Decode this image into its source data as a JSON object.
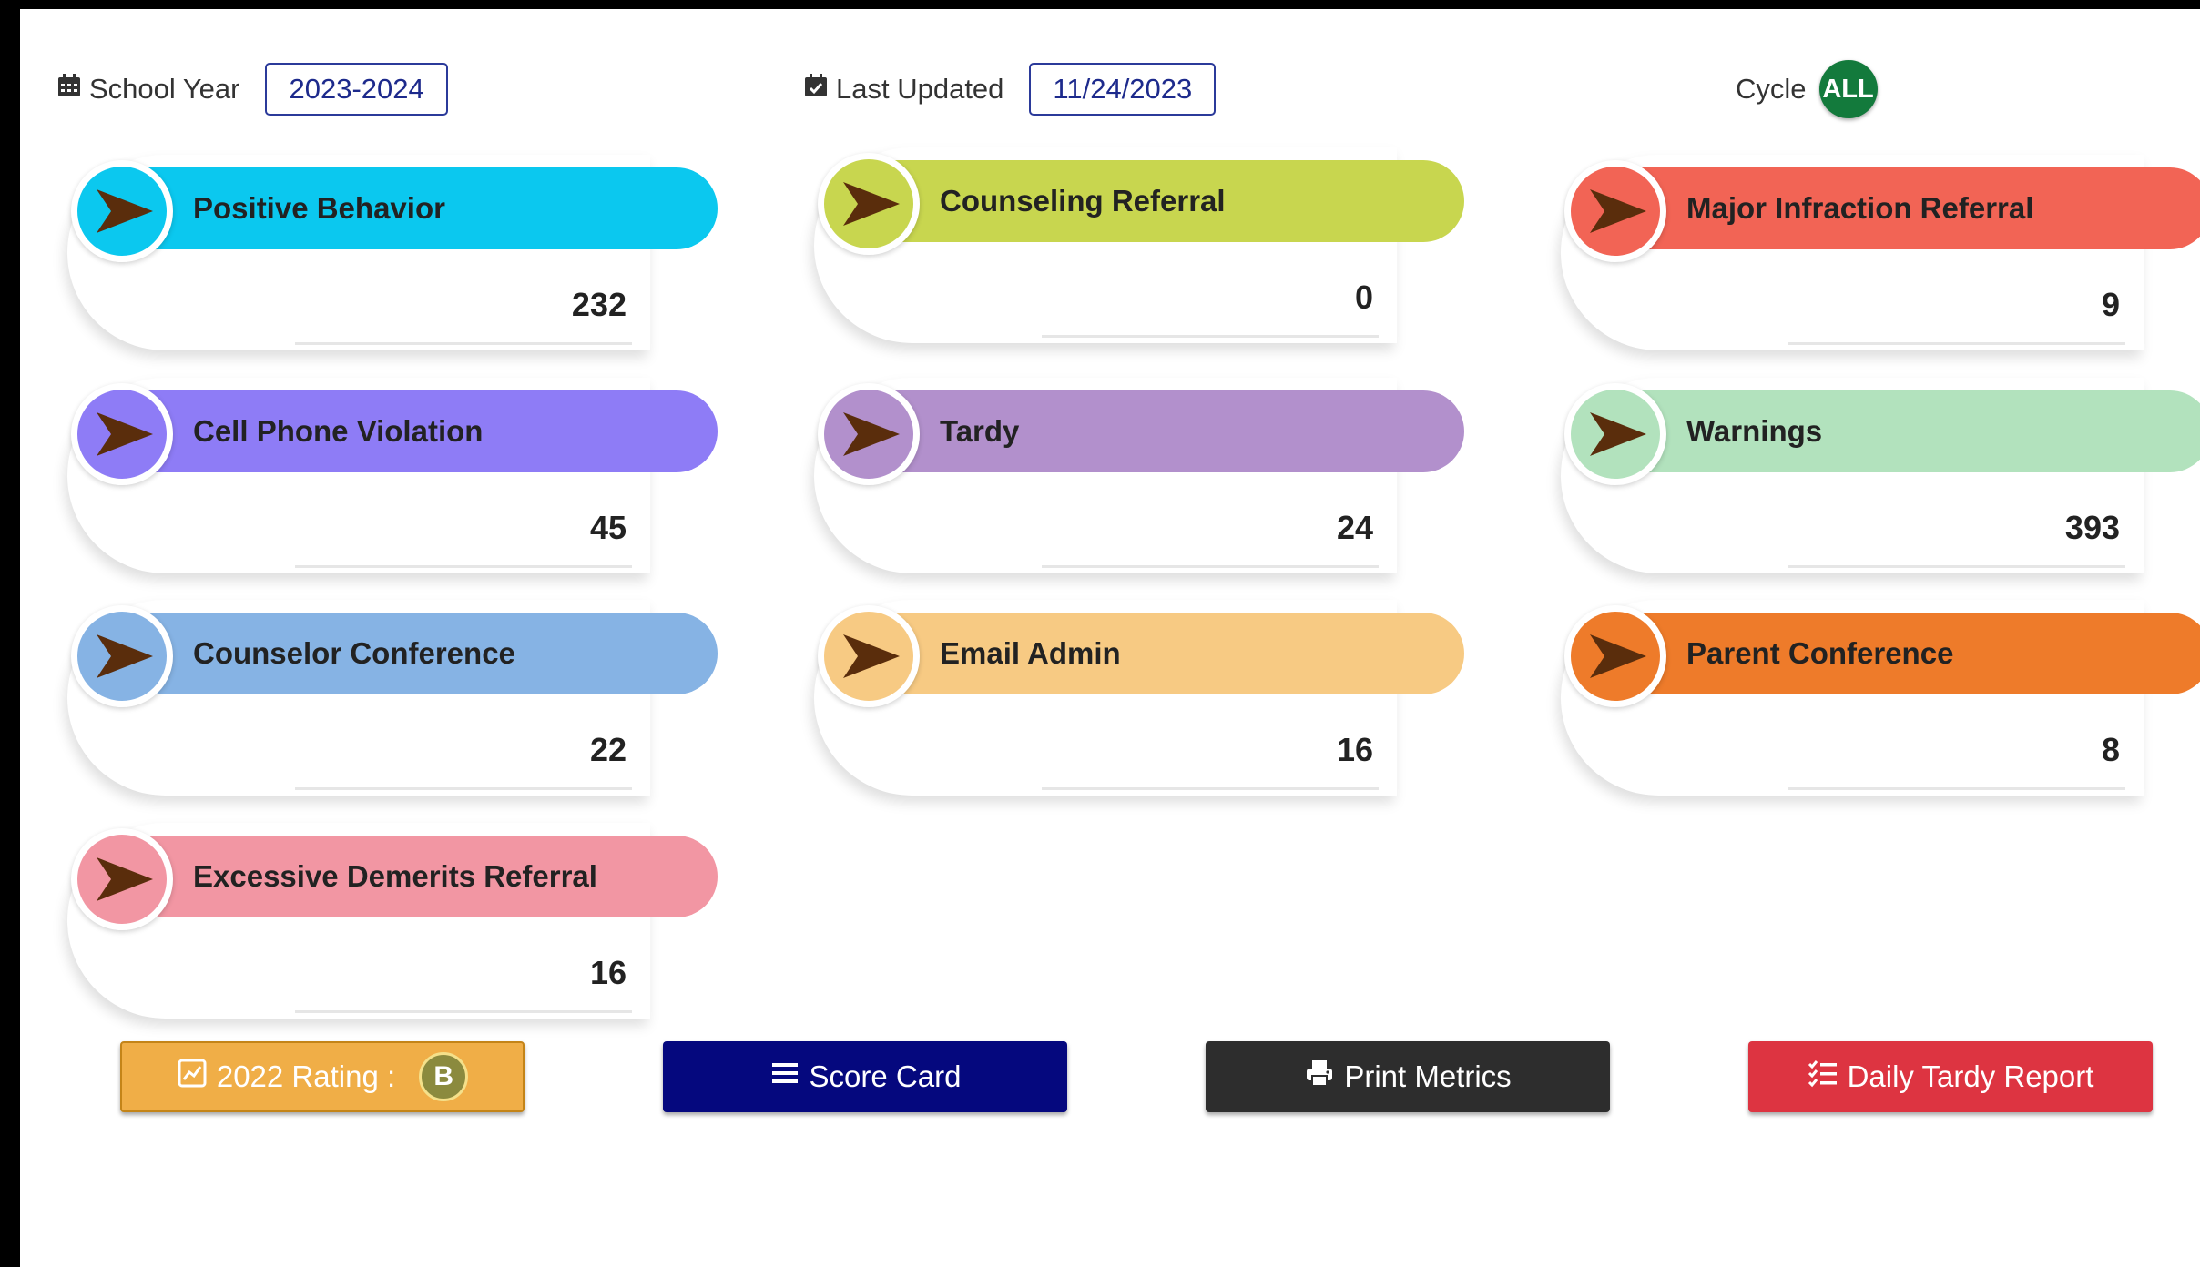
{
  "header": {
    "school_year_label": "School Year",
    "school_year_value": "2023-2024",
    "last_updated_label": "Last Updated",
    "last_updated_value": "11/24/2023",
    "cycle_label": "Cycle",
    "cycle_value": "ALL"
  },
  "colors": {
    "arrow": "#5a2d0c",
    "cycle_badge": "#137a3c"
  },
  "cards": [
    {
      "title": "Positive Behavior",
      "value": "232",
      "color": "#0bc8ef"
    },
    {
      "title": "Counseling Referral",
      "value": "0",
      "color": "#c8d64f"
    },
    {
      "title": "Major Infraction Referral",
      "value": "9",
      "color": "#f26455"
    },
    {
      "title": "Cell Phone Violation",
      "value": "45",
      "color": "#8e7cf6"
    },
    {
      "title": "Tardy",
      "value": "24",
      "color": "#b290cc"
    },
    {
      "title": "Warnings",
      "value": "393",
      "color": "#b2e2bd"
    },
    {
      "title": "Counselor Conference",
      "value": "22",
      "color": "#86b3e4"
    },
    {
      "title": "Email Admin",
      "value": "16",
      "color": "#f7ca83"
    },
    {
      "title": "Parent Conference",
      "value": "8",
      "color": "#ee7b2a"
    },
    {
      "title": "Excessive Demerits Referral",
      "value": "16",
      "color": "#f296a3"
    }
  ],
  "buttons": {
    "rating_label": "2022 Rating :",
    "rating_grade": "B",
    "rating_color": "#f0ae47",
    "score_card_label": "Score Card",
    "score_card_color": "#05087e",
    "print_metrics_label": "Print Metrics",
    "print_metrics_color": "#2d2d2d",
    "daily_tardy_label": "Daily Tardy Report",
    "daily_tardy_color": "#dd3441"
  }
}
